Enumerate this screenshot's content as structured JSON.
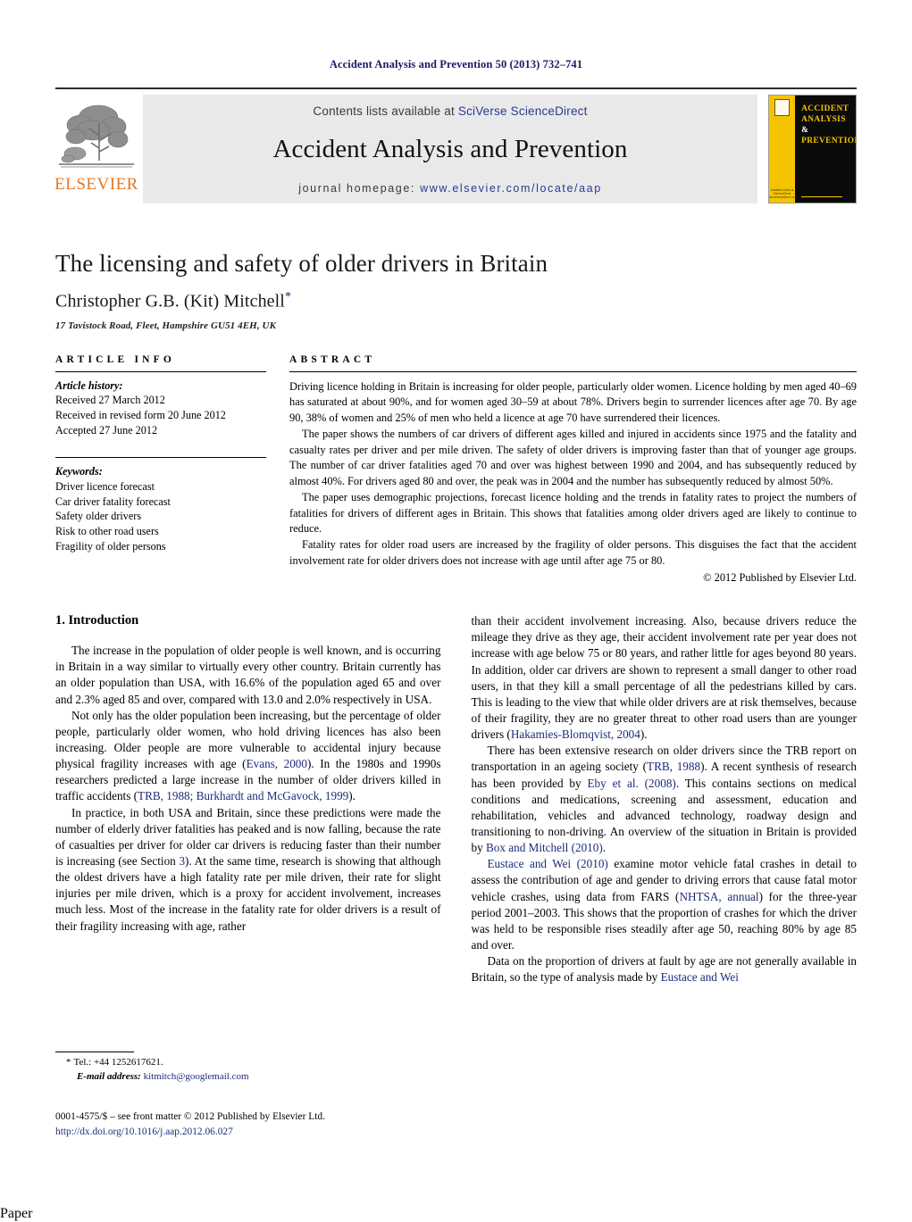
{
  "running_head": "Accident Analysis and Prevention 50 (2013) 732–741",
  "masthead": {
    "publisher_wordmark": "ELSEVIER",
    "contents_prefix": "Contents lists available at",
    "contents_link": "SciVerse ScienceDirect",
    "journal_title": "Accident Analysis and Prevention",
    "homepage_prefix": "journal homepage:",
    "homepage_link": "www.elsevier.com/locate/aap",
    "cover": {
      "line1": "ACCIDENT",
      "line2": "ANALYSIS",
      "line3": "&",
      "line4": "PREVENTION",
      "footmark": "Available online at\nScienceDirect\nwww.sciencedirect.com"
    }
  },
  "title_block": {
    "title": "The licensing and safety of older drivers in Britain",
    "author": "Christopher G.B. (Kit) Mitchell",
    "author_marker": "*",
    "affiliation": "17 Tavistock Road, Fleet, Hampshire GU51 4EH, UK"
  },
  "article_info": {
    "label": "ARTICLE INFO",
    "history_heading": "Article history:",
    "history": [
      "Received 27 March 2012",
      "Received in revised form 20 June 2012",
      "Accepted 27 June 2012"
    ],
    "keywords_heading": "Keywords:",
    "keywords": [
      "Driver licence forecast",
      "Car driver fatality forecast",
      "Safety older drivers",
      "Risk to other road users",
      "Fragility of older persons"
    ]
  },
  "abstract": {
    "label": "ABSTRACT",
    "paragraphs": [
      "Driving licence holding in Britain is increasing for older people, particularly older women. Licence holding by men aged 40–69 has saturated at about 90%, and for women aged 30–59 at about 78%. Drivers begin to surrender licences after age 70. By age 90, 38% of women and 25% of men who held a licence at age 70 have surrendered their licences.",
      "The paper shows the numbers of car drivers of different ages killed and injured in accidents since 1975 and the fatality and casualty rates per driver and per mile driven. The safety of older drivers is improving faster than that of younger age groups. The number of car driver fatalities aged 70 and over was highest between 1990 and 2004, and has subsequently reduced by almost 40%. For drivers aged 80 and over, the peak was in 2004 and the number has subsequently reduced by almost 50%.",
      "The paper uses demographic projections, forecast licence holding and the trends in fatality rates to project the numbers of fatalities for drivers of different ages in Britain. This shows that fatalities among older drivers aged are likely to continue to reduce.",
      "Fatality rates for older road users are increased by the fragility of older persons. This disguises the fact that the accident involvement rate for older drivers does not increase with age until after age 75 or 80."
    ],
    "copyright": "© 2012 Published by Elsevier Ltd."
  },
  "body": {
    "section_heading": "1. Introduction",
    "left_paragraphs": [
      "The increase in the population of older people is well known, and is occurring in Britain in a way similar to virtually every other country. Britain currently has an older population than USA, with 16.6% of the population aged 65 and over and 2.3% aged 85 and over, compared with 13.0 and 2.0% respectively in USA.",
      "Not only has the older population been increasing, but the percentage of older people, particularly older women, who hold driving licences has also been increasing. Older people are more vulnerable to accidental injury because physical fragility increases with age (Evans, 2000). In the 1980s and 1990s researchers predicted a large increase in the number of older drivers killed in traffic accidents (TRB, 1988; Burkhardt and McGavock, 1999).",
      "In practice, in both USA and Britain, since these predictions were made the number of elderly driver fatalities has peaked and is now falling, because the rate of casualties per driver for older car drivers is reducing faster than their number is increasing (see Section 3). At the same time, research is showing that although the oldest drivers have a high fatality rate per mile driven, their rate for slight injuries per mile driven, which is a proxy for accident involvement, increases much less. Most of the increase in the fatality rate for older drivers is a result of their fragility increasing with age, rather"
    ],
    "right_paragraphs": [
      "than their accident involvement increasing. Also, because drivers reduce the mileage they drive as they age, their accident involvement rate per year does not increase with age below 75 or 80 years, and rather little for ages beyond 80 years. In addition, older car drivers are shown to represent a small danger to other road users, in that they kill a small percentage of all the pedestrians killed by cars. This is leading to the view that while older drivers are at risk themselves, because of their fragility, they are no greater threat to other road users than are younger drivers (Hakamies-Blomqvist, 2004).",
      "There has been extensive research on older drivers since the TRB report on transportation in an ageing society (TRB, 1988). A recent synthesis of research has been provided by Eby et al. (2008). This contains sections on medical conditions and medications, screening and assessment, education and rehabilitation, vehicles and advanced technology, roadway design and transitioning to non-driving. An overview of the situation in Britain is provided by Box and Mitchell (2010).",
      "Eustace and Wei (2010) examine motor vehicle fatal crashes in detail to assess the contribution of age and gender to driving errors that cause fatal motor vehicle crashes, using data from FARS (NHTSA, annual) for the three-year period 2001–2003. This shows that the proportion of crashes for which the driver was held to be responsible rises steadily after age 50, reaching 80% by age 85 and over.",
      "Data on the proportion of drivers at fault by age are not generally available in Britain, so the type of analysis made by Eustace and Wei"
    ]
  },
  "footnotes": {
    "marker": "*",
    "tel": "Tel.: +44 1252617621.",
    "email_label": "E-mail address:",
    "email": "kitmitch@googlemail.com"
  },
  "footer": {
    "issn_line": "0001-4575/$ – see front matter © 2012 Published by Elsevier Ltd.",
    "doi": "http://dx.doi.org/10.1016/j.aap.2012.06.027"
  }
}
